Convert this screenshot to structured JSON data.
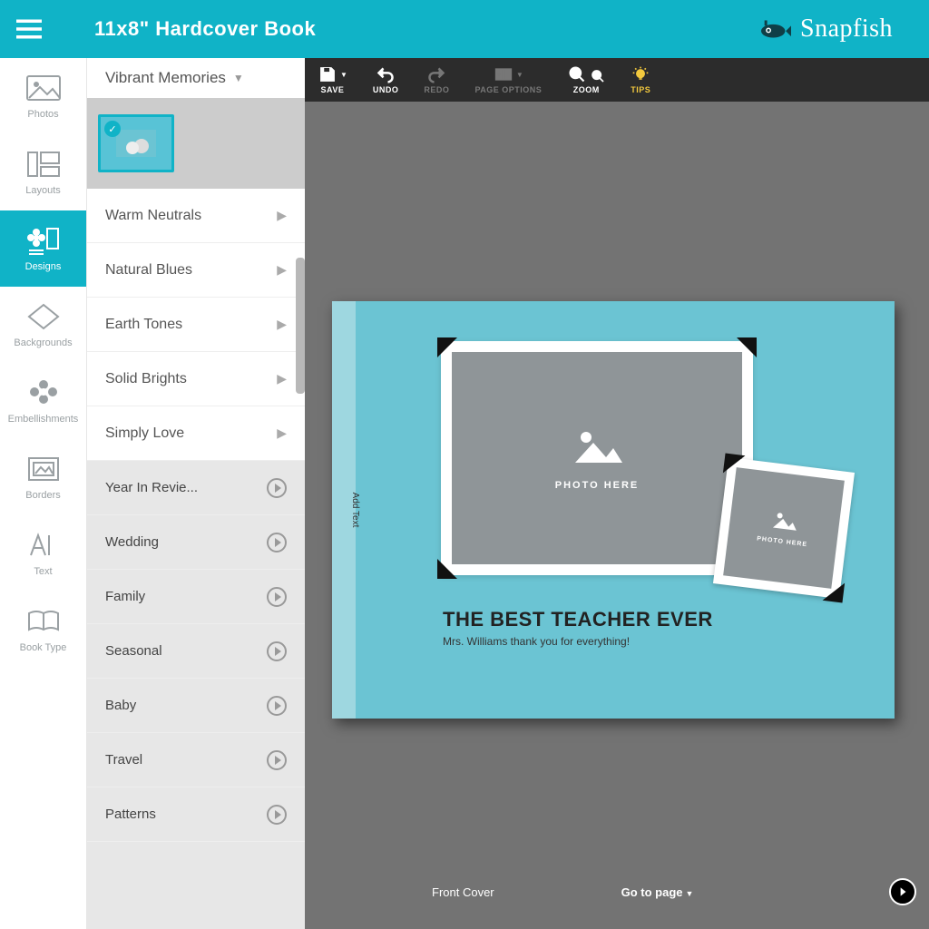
{
  "header": {
    "product_title": "11x8\" Hardcover Book",
    "brand": "Snapfish"
  },
  "rail": {
    "items": [
      {
        "key": "photos",
        "label": "Photos"
      },
      {
        "key": "layouts",
        "label": "Layouts"
      },
      {
        "key": "designs",
        "label": "Designs"
      },
      {
        "key": "backgrounds",
        "label": "Backgrounds"
      },
      {
        "key": "embellishments",
        "label": "Embellishments"
      },
      {
        "key": "borders",
        "label": "Borders"
      },
      {
        "key": "text",
        "label": "Text"
      },
      {
        "key": "booktype",
        "label": "Book Type"
      }
    ]
  },
  "panel": {
    "selected_theme": "Vibrant Memories",
    "sub_themes": [
      "Warm Neutrals",
      "Natural Blues",
      "Earth Tones",
      "Solid Brights",
      "Simply Love"
    ],
    "categories": [
      "Year In Revie...",
      "Wedding",
      "Family",
      "Seasonal",
      "Baby",
      "Travel",
      "Patterns"
    ]
  },
  "toolbar": {
    "save": "SAVE",
    "undo": "UNDO",
    "redo": "REDO",
    "page_options": "PAGE OPTIONS",
    "zoom": "ZOOM",
    "tips": "TIPS"
  },
  "book": {
    "spine_text": "Add Text",
    "photo_here": "PHOTO HERE",
    "title": "THE BEST TEACHER EVER",
    "subtitle": "Mrs. Williams thank you for everything!"
  },
  "footer": {
    "front_cover": "Front Cover",
    "go_to_page": "Go to page"
  }
}
